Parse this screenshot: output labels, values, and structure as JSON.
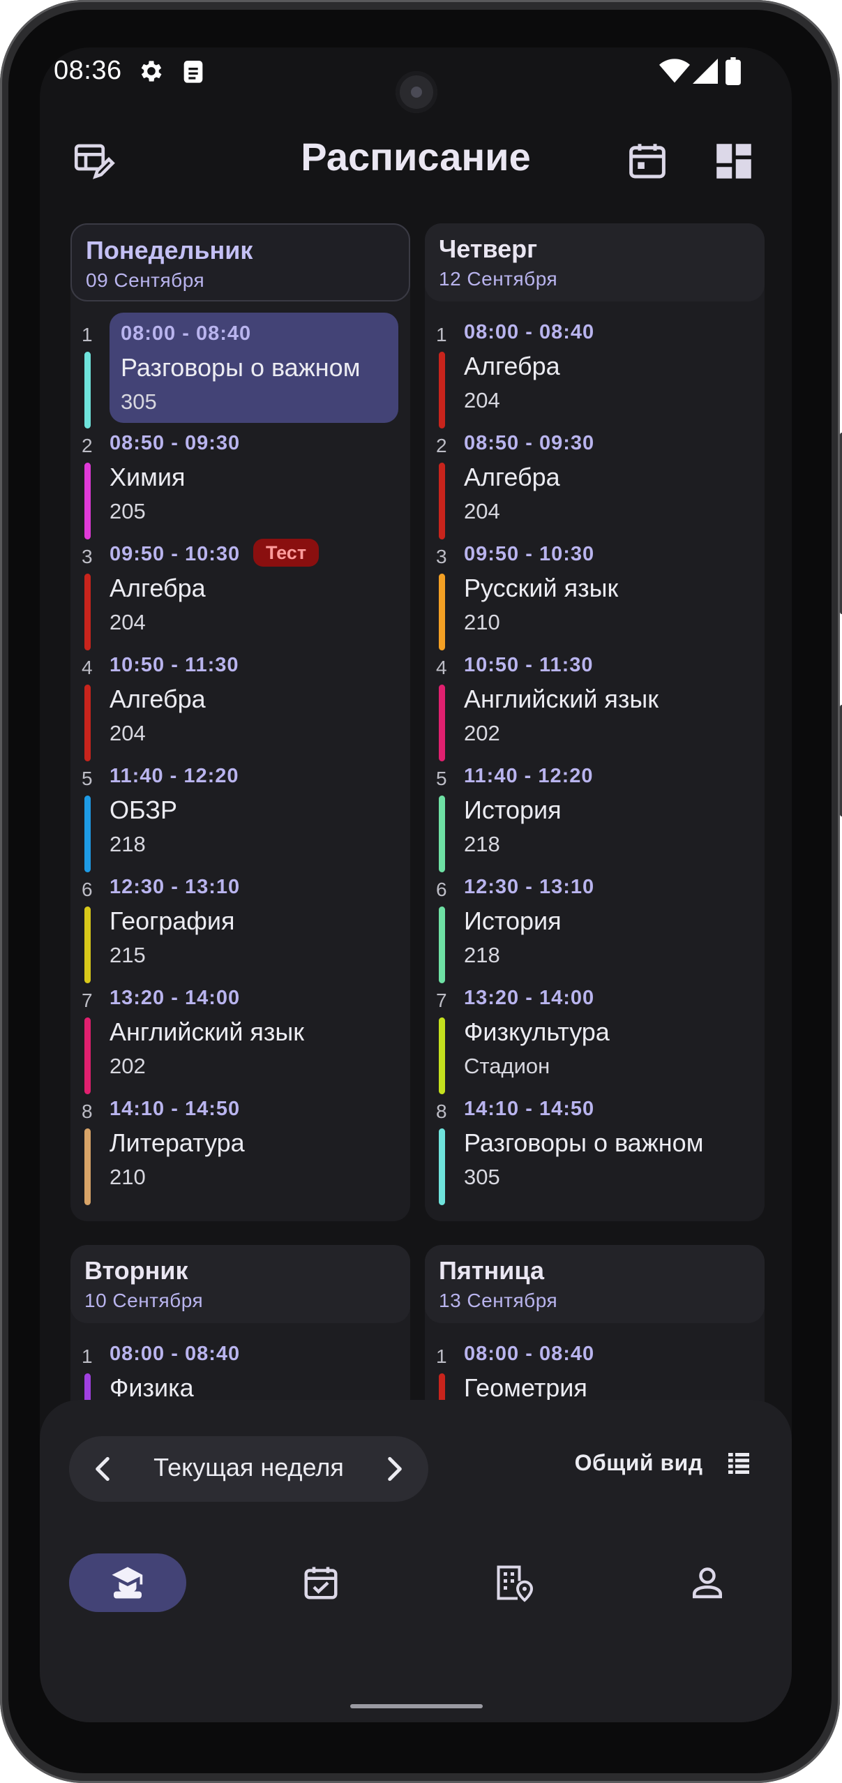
{
  "status_bar": {
    "time": "08:36"
  },
  "header": {
    "title": "Расписание"
  },
  "days": [
    {
      "name": "Понедельник",
      "date": "09 Сентября",
      "current": true,
      "lessons": [
        {
          "num": "1",
          "time": "08:00 - 08:40",
          "subject": "Разговоры о важном",
          "room": "305",
          "color": "#6fe3dc",
          "active": true
        },
        {
          "num": "2",
          "time": "08:50 - 09:30",
          "subject": "Химия",
          "room": "205",
          "color": "#e03ad8"
        },
        {
          "num": "3",
          "time": "09:50 - 10:30",
          "subject": "Алгебра",
          "room": "204",
          "color": "#c8241c",
          "badge": "Тест"
        },
        {
          "num": "4",
          "time": "10:50 - 11:30",
          "subject": "Алгебра",
          "room": "204",
          "color": "#c8241c"
        },
        {
          "num": "5",
          "time": "11:40 - 12:20",
          "subject": "ОБЗР",
          "room": "218",
          "color": "#1e9be6"
        },
        {
          "num": "6",
          "time": "12:30 - 13:10",
          "subject": "География",
          "room": "215",
          "color": "#d8c81a"
        },
        {
          "num": "7",
          "time": "13:20 - 14:00",
          "subject": "Английский язык",
          "room": "202",
          "color": "#e0206f"
        },
        {
          "num": "8",
          "time": "14:10 - 14:50",
          "subject": "Литература",
          "room": "210",
          "color": "#d8a468"
        }
      ]
    },
    {
      "name": "Вторник",
      "date": "10 Сентября",
      "lessons": [
        {
          "num": "1",
          "time": "08:00 - 08:40",
          "subject": "Физика",
          "room": "",
          "color": "#a040e0"
        }
      ]
    },
    {
      "name": "Четверг",
      "date": "12 Сентября",
      "lessons": [
        {
          "num": "1",
          "time": "08:00 - 08:40",
          "subject": "Алгебра",
          "room": "204",
          "color": "#c8241c"
        },
        {
          "num": "2",
          "time": "08:50 - 09:30",
          "subject": "Алгебра",
          "room": "204",
          "color": "#c8241c"
        },
        {
          "num": "3",
          "time": "09:50 - 10:30",
          "subject": "Русский язык",
          "room": "210",
          "color": "#f4a024"
        },
        {
          "num": "4",
          "time": "10:50 - 11:30",
          "subject": "Английский язык",
          "room": "202",
          "color": "#e0206f"
        },
        {
          "num": "5",
          "time": "11:40 - 12:20",
          "subject": "История",
          "room": "218",
          "color": "#6ee0a4"
        },
        {
          "num": "6",
          "time": "12:30 - 13:10",
          "subject": "История",
          "room": "218",
          "color": "#6ee0a4"
        },
        {
          "num": "7",
          "time": "13:20 - 14:00",
          "subject": "Физкультура",
          "room": "Стадион",
          "color": "#c4e01e"
        },
        {
          "num": "8",
          "time": "14:10 - 14:50",
          "subject": "Разговоры о важном",
          "room": "305",
          "color": "#6fe3dc"
        }
      ]
    },
    {
      "name": "Пятница",
      "date": "13 Сентября",
      "lessons": [
        {
          "num": "1",
          "time": "08:00 - 08:40",
          "subject": "Геометрия",
          "room": "",
          "color": "#c8241c"
        }
      ]
    }
  ],
  "week_nav": {
    "label": "Текущая неделя"
  },
  "overview": {
    "label": "Общий вид"
  },
  "bottom_nav": [
    {
      "icon": "graduation-cap-icon",
      "active": true
    },
    {
      "icon": "calendar-check-icon"
    },
    {
      "icon": "building-location-icon"
    },
    {
      "icon": "person-icon"
    }
  ]
}
